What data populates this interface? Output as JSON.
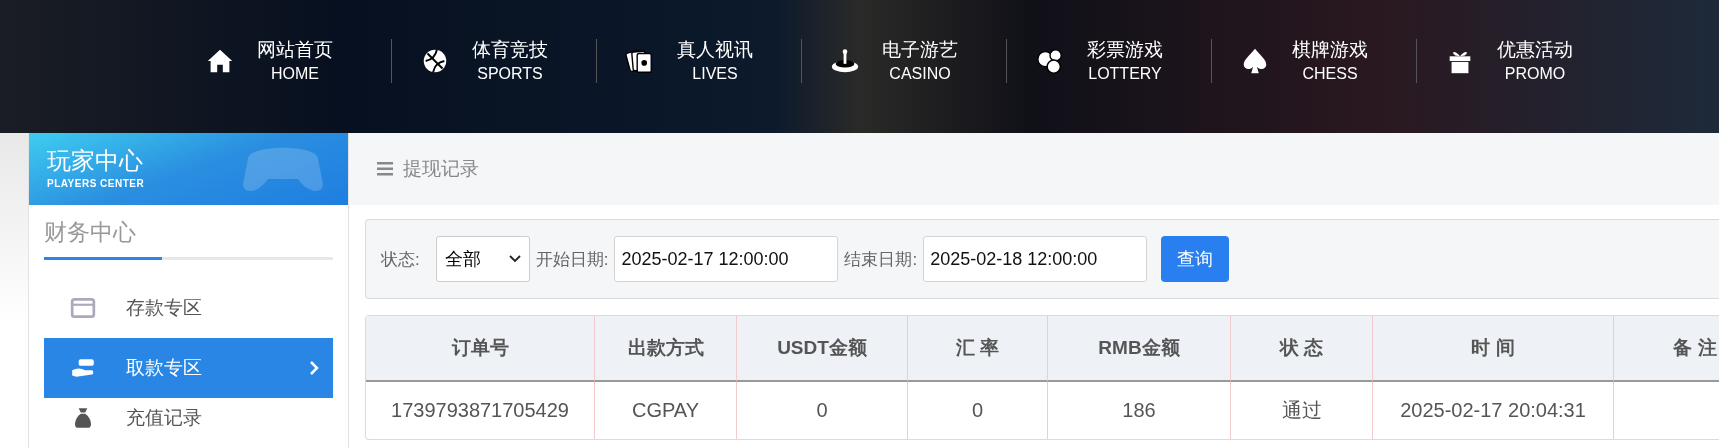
{
  "nav": [
    {
      "label": "网站首页",
      "sub": "HOME",
      "kind": "home"
    },
    {
      "label": "体育竞技",
      "sub": "SPORTS",
      "kind": "ball"
    },
    {
      "label": "真人视讯",
      "sub": "LIVES",
      "kind": "cards"
    },
    {
      "label": "电子游艺",
      "sub": "CASINO",
      "kind": "roulette"
    },
    {
      "label": "彩票游戏",
      "sub": "LOTTERY",
      "kind": "balls"
    },
    {
      "label": "棋牌游戏",
      "sub": "CHESS",
      "kind": "spade"
    },
    {
      "label": "优惠活动",
      "sub": "PROMO",
      "kind": "gift"
    }
  ],
  "sidebar": {
    "title": "玩家中心",
    "subtitle": "PLAYERS CENTER",
    "section": "财务中心",
    "items": [
      {
        "label": "存款专区",
        "kind": "card",
        "selected": false
      },
      {
        "label": "取款专区",
        "kind": "hand",
        "selected": true
      },
      {
        "label": "充值记录",
        "kind": "bag",
        "selected": false
      }
    ]
  },
  "page_title": "提现记录",
  "filter": {
    "status_label": "状态:",
    "status_value": "全部",
    "start_label": "开始日期:",
    "start_value": "2025-02-17 12:00:00",
    "end_label": "结束日期:",
    "end_value": "2025-02-18 12:00:00",
    "button": "查询"
  },
  "table": {
    "columns": [
      "订单号",
      "出款方式",
      "USDT金额",
      "汇 率",
      "RMB金额",
      "状 态",
      "时 间",
      "备 注"
    ],
    "rows": [
      [
        "1739793871705429",
        "CGPAY",
        "0",
        "0",
        "186",
        "通过",
        "2025-02-17 20:04:31",
        ""
      ]
    ]
  }
}
